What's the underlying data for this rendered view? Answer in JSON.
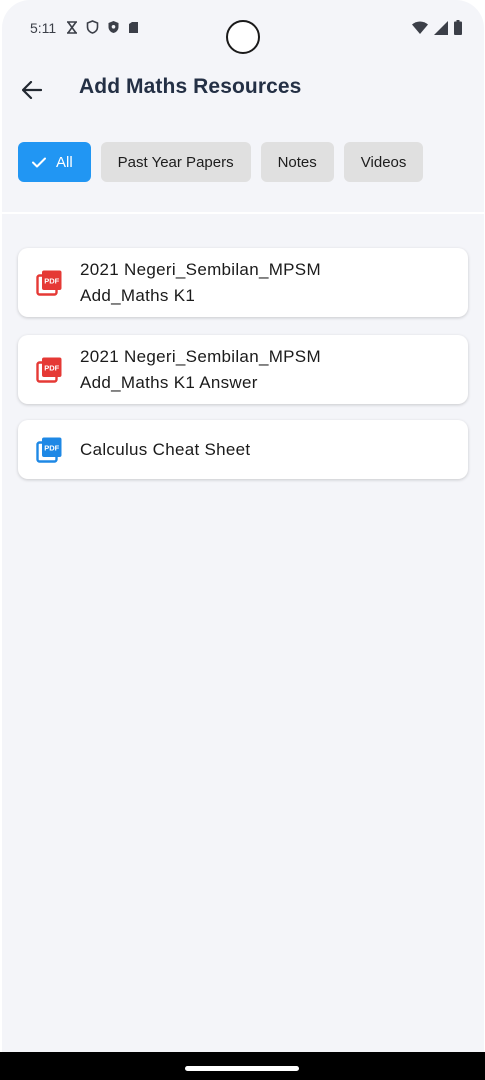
{
  "status_bar": {
    "time": "5:11",
    "left_icons": [
      "hourglass-icon",
      "shield-icon",
      "shield-filled-icon",
      "sim-card-icon"
    ],
    "right_icons": [
      "wifi-icon",
      "signal-icon",
      "battery-icon"
    ]
  },
  "app_bar": {
    "title": "Add Maths Resources",
    "back_icon": "arrow-left-icon"
  },
  "filters": [
    {
      "label": "All",
      "selected": true
    },
    {
      "label": "Past Year Papers",
      "selected": false
    },
    {
      "label": "Notes",
      "selected": false
    },
    {
      "label": "Videos",
      "selected": false
    }
  ],
  "resources": [
    {
      "line1": "2021 Negeri_Sembilan_MPSM",
      "line2": "Add_Maths K1",
      "icon": "pdf-icon",
      "icon_color": "#e53935"
    },
    {
      "line1": "2021 Negeri_Sembilan_MPSM",
      "line2": "Add_Maths K1 Answer",
      "icon": "pdf-icon",
      "icon_color": "#e53935"
    },
    {
      "line1": "Calculus Cheat Sheet",
      "icon": "pdf-icon",
      "icon_color": "#1e88e5"
    }
  ],
  "colors": {
    "accent": "#2196f3",
    "background": "#f4f5f9",
    "chip_background": "#e0e0e0",
    "title": "#243045"
  }
}
